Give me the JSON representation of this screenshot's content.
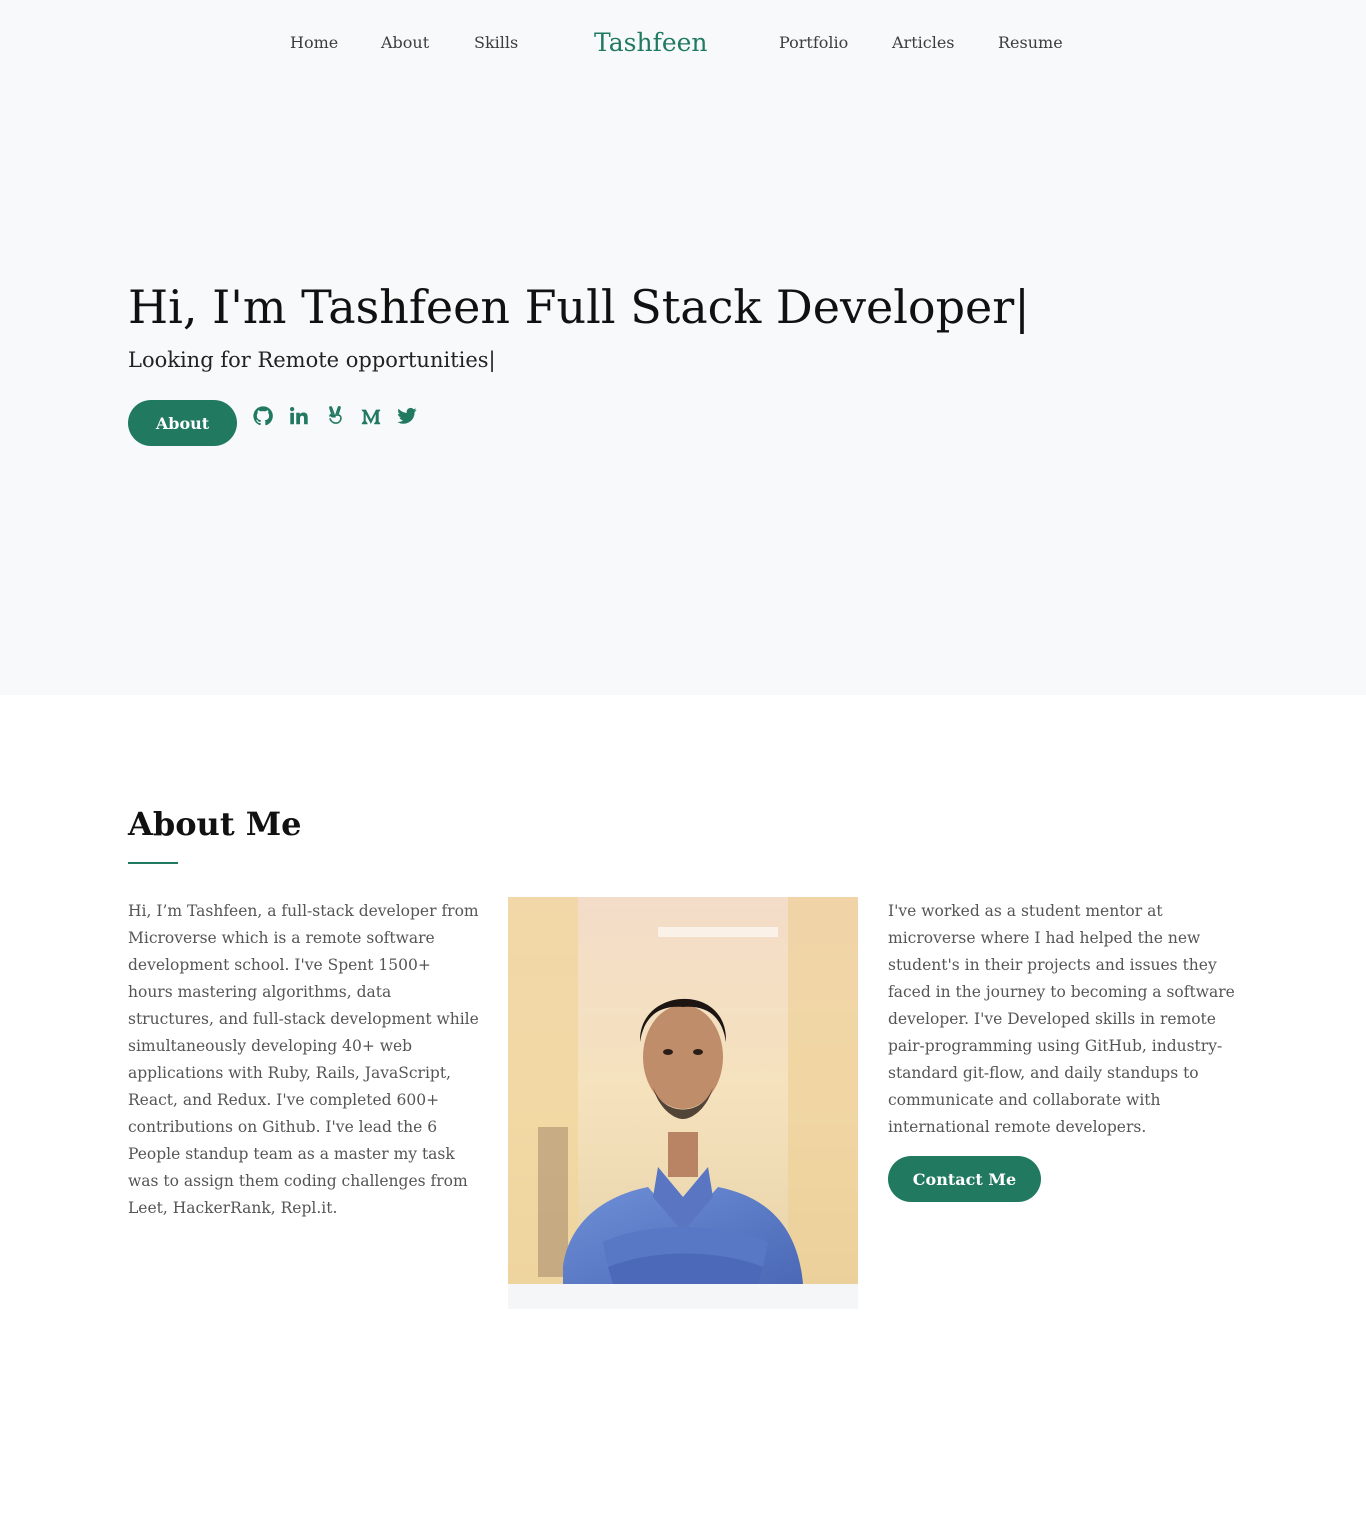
{
  "nav": {
    "brand": "Tashfeen",
    "links": [
      "Home",
      "About",
      "Skills",
      "Portfolio",
      "Articles",
      "Resume"
    ]
  },
  "hero": {
    "title": "Hi, I'm Tashfeen Full Stack Developer|",
    "subtitle": "Looking for Remote opportunities|",
    "about_button": "About",
    "socials": [
      "github-icon",
      "linkedin-icon",
      "angellist-icon",
      "medium-icon",
      "twitter-icon"
    ]
  },
  "about": {
    "title": "About Me",
    "left_text": "Hi, I’m Tashfeen, a full-stack developer from Microverse which is a remote software development school. I've Spent 1500+ hours mastering algorithms, data structures, and full-stack development while simultaneously developing 40+ web applications with Ruby, Rails, JavaScript, React, and Redux. I've completed 600+ contributions on Github. I've lead the 6 People standup team as a master my task was to assign them coding challenges from Leet, HackerRank, Repl.it.",
    "right_text": "I've worked as a student mentor at microverse where I had helped the new student's in their projects and issues they faced in the journey to becoming a software developer. I've Developed skills in remote pair-programming using GitHub, industry-standard git-flow, and daily standups to communicate and collaborate with international remote developers.",
    "contact_button": "Contact Me"
  },
  "colors": {
    "accent": "#217a60",
    "hero_bg": "#f8f9fa"
  }
}
